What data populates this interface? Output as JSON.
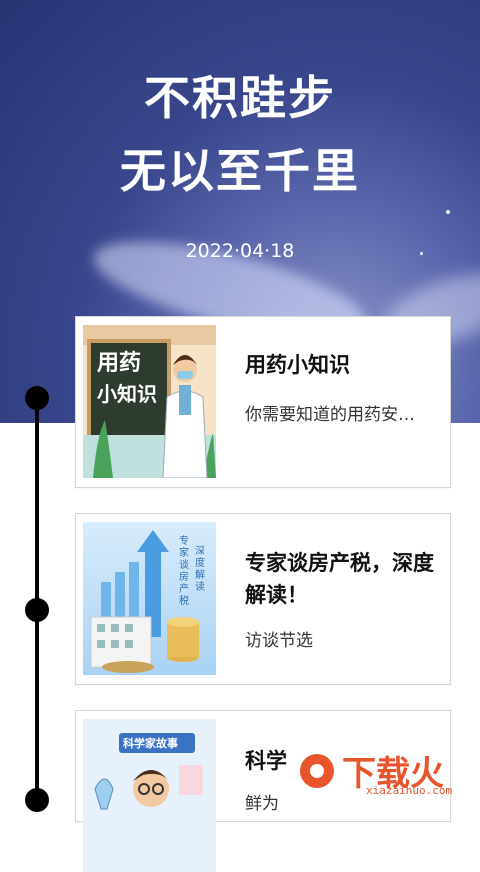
{
  "hero": {
    "line1": "不积跬步",
    "line2": "无以至千里",
    "date": "2022·04·18"
  },
  "cards": [
    {
      "title": "用药小知识",
      "subtitle": "你需要知道的用药安…",
      "thumb_text": [
        "用药",
        "小知识"
      ]
    },
    {
      "title": "专家谈房产税，深度解读！",
      "subtitle": "访谈节选",
      "thumb_text": [
        "专家谈房产税",
        "深度解读"
      ]
    },
    {
      "title": "科学",
      "subtitle": "鲜为",
      "thumb_text": [
        "科学家故事"
      ]
    }
  ],
  "watermark": {
    "name": "下载火",
    "url": "xiazaihuo.com"
  },
  "colors": {
    "accent": "#e8542c",
    "hero_dark": "#263574",
    "timeline": "#000000"
  }
}
